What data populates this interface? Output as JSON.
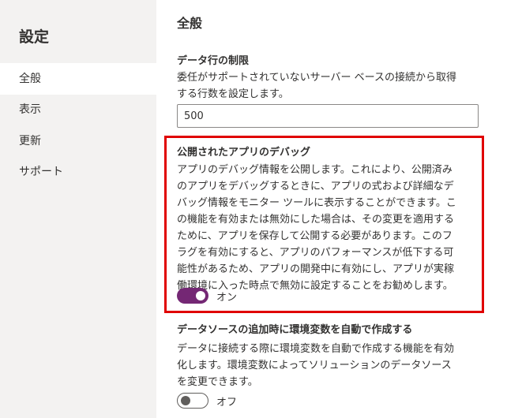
{
  "sidebar": {
    "title": "設定",
    "items": [
      {
        "label": "全般",
        "selected": true
      },
      {
        "label": "表示",
        "selected": false
      },
      {
        "label": "更新",
        "selected": false
      },
      {
        "label": "サポート",
        "selected": false
      }
    ]
  },
  "main": {
    "heading": "全般",
    "row_limit": {
      "label": "データ行の制限",
      "desc_lines": [
        "委任がサポートされていないサーバー ベースの接続から取得",
        "する行数を設定します。"
      ],
      "value": "500"
    },
    "debug": {
      "label": "公開されたアプリのデバッグ",
      "desc_lines": [
        "アプリのデバッグ情報を公開します。これにより、公開済み",
        "のアプリをデバッグするときに、アプリの式および詳細なデ",
        "バッグ情報をモニター ツールに表示することができます。こ",
        "の機能を有効または無効にした場合は、その変更を適用する",
        "ために、アプリを保存して公開する必要があります。このフ",
        "ラグを有効にすると、アプリのパフォーマンスが低下する可",
        "能性があるため、アプリの開発中に有効にし、アプリが実稼",
        "働環境に入った時点で無効に設定することをお勧めします。"
      ],
      "toggle_state": "on",
      "toggle_label": "オン"
    },
    "env_vars": {
      "label": "データソースの追加時に環境変数を自動で作成する",
      "desc_lines": [
        "データに接続する際に環境変数を自動で作成する機能を有効",
        "化します。環境変数によってソリューションのデータソース",
        "を変更できます。"
      ],
      "toggle_state": "off",
      "toggle_label": "オフ"
    }
  },
  "colors": {
    "accent": "#742774",
    "highlight": "#e00000",
    "sidebar_bg": "#f3f2f1"
  }
}
